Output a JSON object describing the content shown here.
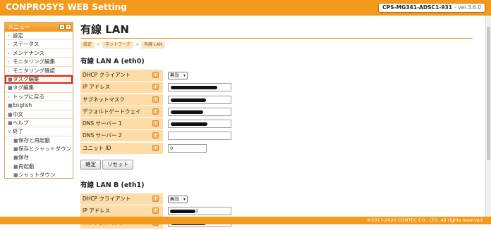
{
  "app": {
    "title": "CONPROSYS WEB Setting",
    "model": "CPS-MG341-ADSC1-931",
    "version": "- ver.3.6.0"
  },
  "sidebar": {
    "header": "メニュー",
    "items": [
      {
        "label": "設定",
        "marker": "›"
      },
      {
        "label": "ステータス",
        "marker": "›"
      },
      {
        "label": "メンテナンス",
        "marker": "›"
      },
      {
        "label": "モニタリング編集",
        "marker": "›"
      },
      {
        "label": "モニタリング確認",
        "marker": "›"
      },
      {
        "label": "タスク編集",
        "marker": "■"
      },
      {
        "label": "タグ編集",
        "marker": "■"
      },
      {
        "label": "トップに戻る",
        "marker": "›"
      },
      {
        "label": "English",
        "marker": "■"
      },
      {
        "label": "中文",
        "marker": "■"
      },
      {
        "label": "ヘルプ",
        "marker": "■"
      },
      {
        "label": "終了",
        "marker": "∨"
      }
    ],
    "subitems": [
      {
        "label": "保存と再起動"
      },
      {
        "label": "保存とシャットダウン"
      },
      {
        "label": "保存"
      },
      {
        "label": "再起動"
      },
      {
        "label": "シャットダウン"
      }
    ]
  },
  "main": {
    "title": "有線 LAN",
    "breadcrumb": [
      "設定",
      "ネットワーク",
      "有線 LAN"
    ],
    "breadcrumb_sep": ">",
    "section_a": "有線 LAN A (eth0)",
    "section_b": "有線 LAN B (eth1)",
    "form_a": [
      {
        "label": "DHCP クライアント",
        "type": "select",
        "value": "無効"
      },
      {
        "label": "IP アドレス",
        "type": "text",
        "value": ""
      },
      {
        "label": "サブネットマスク",
        "type": "text",
        "value": ""
      },
      {
        "label": "デフォルトゲートウェイ",
        "type": "text",
        "value": ""
      },
      {
        "label": "DNS サーバー 1",
        "type": "text",
        "value": ""
      },
      {
        "label": "DNS サーバー 2",
        "type": "text",
        "value": ""
      },
      {
        "label": "ユニット ID",
        "type": "text",
        "value": "0"
      }
    ],
    "form_b": [
      {
        "label": "DHCP クライアント",
        "type": "select",
        "value": "無効"
      },
      {
        "label": "IP アドレス",
        "type": "text",
        "value": "1"
      },
      {
        "label": "サブネットマスク",
        "type": "text",
        "value": ""
      }
    ],
    "confirm_button": "確定",
    "reset_button": "リセット",
    "help_glyph": "?"
  },
  "footer": {
    "copyright": "©2017-2020 CONTEC CO., LTD. All rights reserved."
  },
  "colors": {
    "accent": "#f39a1d",
    "label_bg": "#fddca8",
    "selected_outline": "#e02020"
  }
}
